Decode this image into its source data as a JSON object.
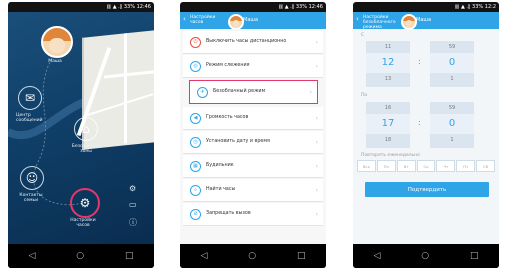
{
  "status": {
    "time": "12:46",
    "time3": "12:2",
    "battery": "33%",
    "signal": "▥ ▲ .∥ 33%"
  },
  "phone1": {
    "avatar_label": "Маша",
    "center_label": "Центр сообщений",
    "safe_label": "Безопасные зоны",
    "contacts_label": "Контакты семьи",
    "settings_label": "Настройки часов"
  },
  "phone2": {
    "title": "Настройки часов",
    "name": "Маша",
    "items": [
      {
        "label": "Выключить часы дистанционно",
        "icon": "power-icon"
      },
      {
        "label": "Режим слежения",
        "icon": "location-icon"
      },
      {
        "label": "Безоблачный режим",
        "icon": "plane-icon"
      },
      {
        "label": "Громкость часов",
        "icon": "volume-icon"
      },
      {
        "label": "Установить дату и время",
        "icon": "clock-icon"
      },
      {
        "label": "Будильник",
        "icon": "calendar-icon"
      },
      {
        "label": "Найти часы",
        "icon": "find-icon"
      },
      {
        "label": "Запрещать вызов",
        "icon": "block-icon"
      }
    ]
  },
  "phone3": {
    "title": "Настройки безоблачного режима",
    "name": "Маша",
    "from_label": "С",
    "to_label": "По",
    "from": {
      "h_prev": "11",
      "h": "12",
      "h_next": "13",
      "m_prev": "59",
      "m": "0",
      "m_next": "1"
    },
    "to": {
      "h_prev": "16",
      "h": "17",
      "h_next": "18",
      "m_prev": "59",
      "m": "0",
      "m_next": "1"
    },
    "repeat_label": "Повторять еженедельно",
    "days": [
      "Вск",
      "Пн",
      "Вт",
      "Ср",
      "Чт",
      "Пт",
      "Сб"
    ],
    "confirm": "Подтвердить"
  },
  "nav": {
    "back": "◁",
    "home": "○",
    "recent": "□"
  }
}
